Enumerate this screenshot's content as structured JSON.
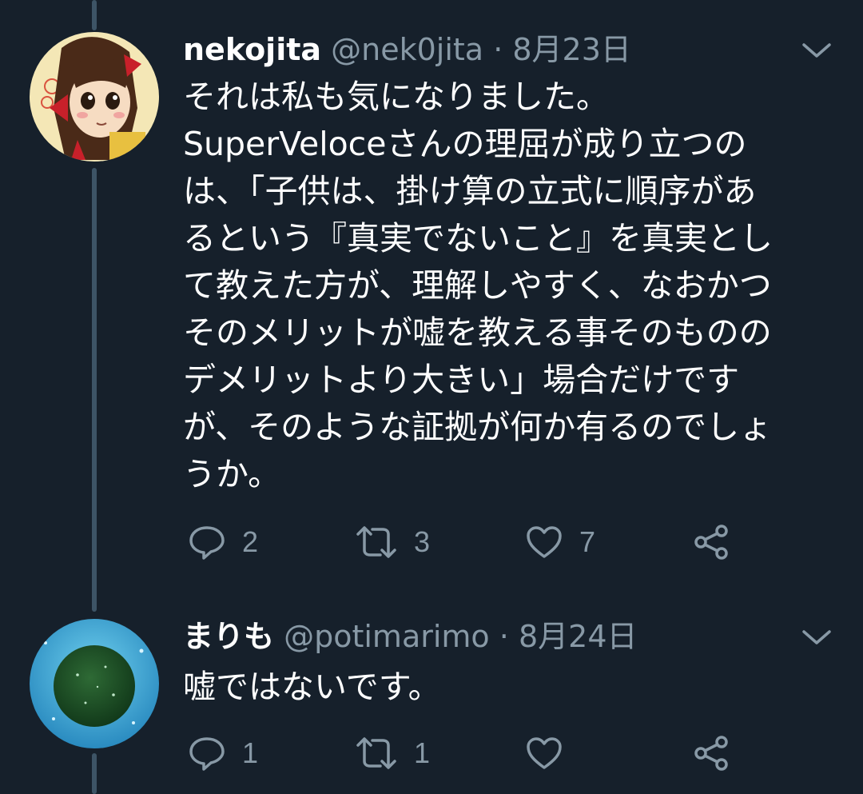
{
  "thread": [
    {
      "display_name": "nekojita",
      "handle": "@nek0jita",
      "separator": "·",
      "date": "8月23日",
      "text": "それは私も気になりました。\nSuperVeloceさんの理屈が成り立つの\nは、「子供は、掛け算の立式に順序があ\nるという『真実でないこと』を真実とし\nて教えた方が、理解しやすく、なおかつ\nそのメリットが嘘を教える事そのものの\nデメリットより大きい」場合だけです\nが、そのような証拠が何か有るのでしょ\nうか。",
      "reply_count": "2",
      "retweet_count": "3",
      "like_count": "7",
      "avatar_icon": "anime-girl-avatar"
    },
    {
      "display_name": "まりも",
      "handle": "@potimarimo",
      "separator": "·",
      "date": "8月24日",
      "text": "嘘ではないです。",
      "reply_count": "1",
      "retweet_count": "1",
      "like_count": "",
      "avatar_icon": "marimo-moss-ball-avatar"
    }
  ],
  "colors": {
    "background": "#16202b",
    "thread_line": "#3d5466",
    "secondary_text": "#8899a6",
    "primary_text": "#ffffff"
  }
}
